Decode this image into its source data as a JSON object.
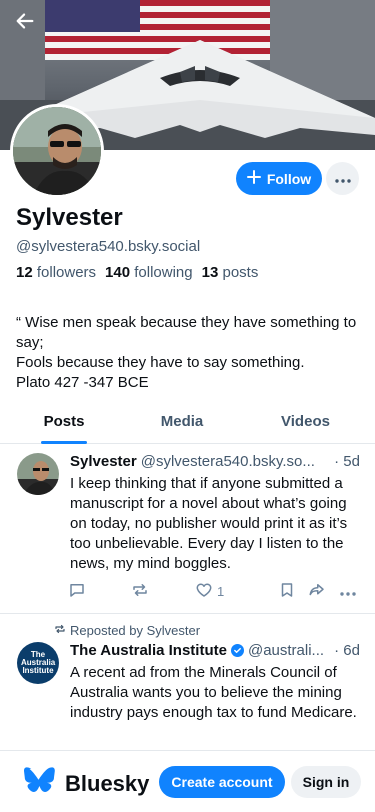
{
  "profile": {
    "display_name": "Sylvester",
    "handle": "@sylvestera540.bsky.social",
    "followers_count": "12",
    "followers_label": "followers",
    "following_count": "140",
    "following_label": "following",
    "posts_count": "13",
    "posts_label": "posts",
    "bio": "“ Wise men speak because they have something to say;\nFools because they have to say something.\n Plato 427 -347 BCE",
    "follow_label": "Follow"
  },
  "tabs": [
    {
      "label": "Posts",
      "active": true
    },
    {
      "label": "Media",
      "active": false
    },
    {
      "label": "Videos",
      "active": false
    }
  ],
  "feed": [
    {
      "author": "Sylvester",
      "handle": "@sylvestera540.bsky.so...",
      "time": "· 5d",
      "text": "I keep thinking that if anyone submitted a manuscript for a novel about what’s going on today, no publisher would print it as it’s too unbelievable. Every day I listen to the news, my mind boggles.",
      "like_count": "1"
    },
    {
      "repost_label": "Reposted by Sylvester",
      "author": "The Australia Institute",
      "handle": "@australi...",
      "time": "· 6d",
      "text": "A recent ad from the Minerals Council of Australia wants you to believe the mining industry pays enough tax to fund Medicare.",
      "avatar_text": "The Australia Institute"
    }
  ],
  "bottom_bar": {
    "brand": "Bluesky",
    "create_label": "Create account",
    "signin_label": "Sign in"
  },
  "colors": {
    "accent": "#1083fe",
    "muted": "#42576c"
  }
}
